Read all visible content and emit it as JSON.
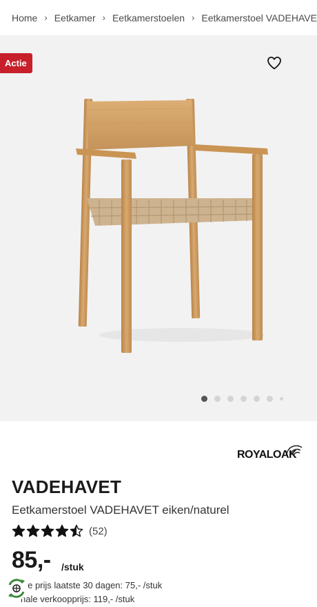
{
  "breadcrumb": {
    "items": [
      "Home",
      "Eetkamer",
      "Eetkamerstoelen",
      "Eetkamerstoel VADEHAVET"
    ]
  },
  "gallery": {
    "badge": "Actie",
    "image_count": 7,
    "active_index": 0
  },
  "brand": {
    "name": "ROYALOAK"
  },
  "product": {
    "title": "VADEHAVET",
    "subtitle": "Eetkamerstoel VADEHAVET eiken/naturel",
    "rating": 4.5,
    "reviews": "(52)",
    "price": "85,-",
    "unit": "/stuk",
    "lowest_price_note": "ste prijs laatste 30 dagen: 75,- /stuk",
    "original_price_note": "nale verkoopprijs: 119,- /stuk"
  },
  "colors": {
    "badge": "#c8202a",
    "gallery_bg": "#f2f2f2",
    "wood": "#c9985c",
    "eco_green": "#3a8a3a"
  },
  "icons": [
    "chevron-right-icon",
    "heart-icon",
    "star-icon",
    "half-star-icon",
    "eco-icon",
    "royaloak-logo"
  ]
}
